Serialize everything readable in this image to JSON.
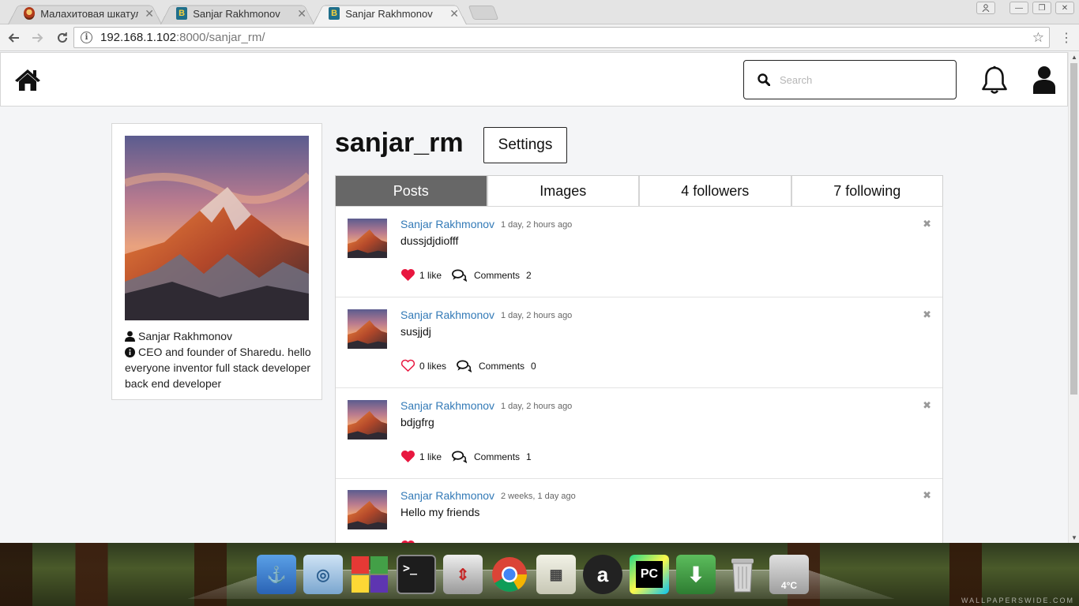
{
  "browser": {
    "tabs": [
      {
        "title": "Малахитовая шкатулка",
        "favicon": "m",
        "active": false
      },
      {
        "title": "Sanjar Rakhmonov",
        "favicon": "b",
        "active": false
      },
      {
        "title": "Sanjar Rakhmonov",
        "favicon": "b",
        "active": true
      }
    ],
    "favicon_letter": "B",
    "close_glyph": "✕",
    "url_host": "192.168.1.102",
    "url_path": ":8000/sanjar_rm/",
    "icons": [
      "back-icon",
      "forward-icon",
      "reload-icon",
      "info-icon",
      "star-icon",
      "menu-icon"
    ]
  },
  "nav": {
    "search_placeholder": "Search",
    "icons": [
      "home-icon",
      "search-icon",
      "bell-icon",
      "user-icon"
    ]
  },
  "profile": {
    "full_name": "Sanjar Rakhmonov",
    "bio": "CEO and founder of Sharedu. hello everyone inventor full stack developer back end developer",
    "username": "sanjar_rm",
    "settings_label": "Settings"
  },
  "tabs": [
    {
      "label": "Posts",
      "active": true
    },
    {
      "label": "Images",
      "active": false
    },
    {
      "label": "4 followers",
      "active": false
    },
    {
      "label": "7 following",
      "active": false
    }
  ],
  "posts": [
    {
      "author": "Sanjar Rakhmonov",
      "time": "1 day, 2 hours ago",
      "text": "dussjdjdiofff",
      "liked": true,
      "likes_label": "1 like",
      "comments_label": "Comments",
      "comments_count": "2"
    },
    {
      "author": "Sanjar Rakhmonov",
      "time": "1 day, 2 hours ago",
      "text": "susjjdj",
      "liked": false,
      "likes_label": "0 likes",
      "comments_label": "Comments",
      "comments_count": "0"
    },
    {
      "author": "Sanjar Rakhmonov",
      "time": "1 day, 2 hours ago",
      "text": "bdjgfrg",
      "liked": true,
      "likes_label": "1 like",
      "comments_label": "Comments",
      "comments_count": "1"
    },
    {
      "author": "Sanjar Rakhmonov",
      "time": "2 weeks, 1 day ago",
      "text": "Hello my friends",
      "liked": true,
      "likes_label": "",
      "comments_label": "",
      "comments_count": ""
    }
  ],
  "post_close_glyph": "✖",
  "colors": {
    "link": "#337ab7",
    "heart": "#e8173f",
    "active_tab": "#676767"
  },
  "dock": {
    "weather": "4°C",
    "terminal_prompt": ">_",
    "watermark": "WALLPAPERSWIDE.COM",
    "apps": [
      "anchor-icon",
      "nautilus-icon",
      "tiles-icon",
      "terminal-icon",
      "scale-icon",
      "chrome-icon",
      "calculator-icon",
      "amazon-icon",
      "pycharm-icon",
      "download-icon",
      "trash-icon",
      "weather-icon"
    ]
  }
}
